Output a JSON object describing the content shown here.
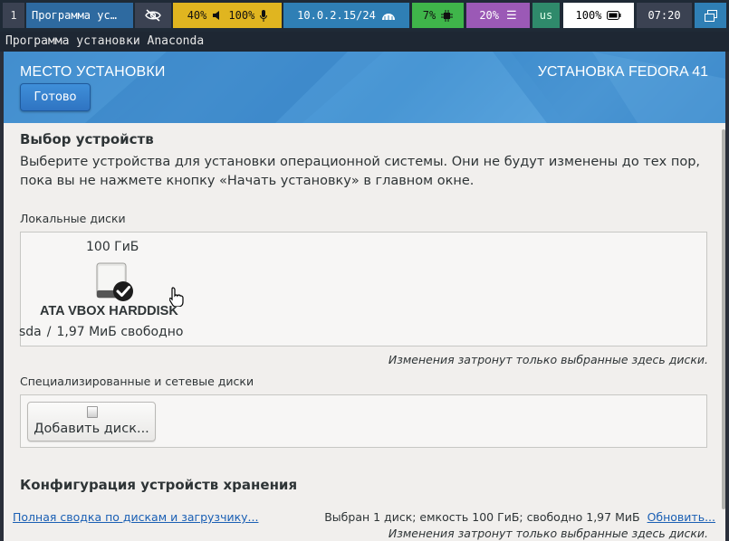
{
  "topbar": {
    "workspace": "1",
    "window_title": "Программа ус…",
    "volume": "40%",
    "mic": "100%",
    "network": "10.0.2.15/24",
    "cpu": "7%",
    "memory": "20%",
    "keyboard": "us",
    "battery": "100%",
    "clock": "07:20",
    "colors": {
      "audio": "#e0b520",
      "network": "#2f7fb5",
      "cpu": "#3fb54a",
      "memory": "#9b59b6",
      "keyboard": "#2f8a6b"
    }
  },
  "window": {
    "title": "Программа установки Anaconda"
  },
  "header": {
    "title": "МЕСТО УСТАНОВКИ",
    "product": "УСТАНОВКА FEDORA 41",
    "done_label": "Готово"
  },
  "device_selection": {
    "heading": "Выбор устройств",
    "description": "Выберите устройства для установки операционной системы. Они не будут изменены до тех пор, пока вы не нажмете кнопку «Начать установку» в главном окне."
  },
  "local_disks": {
    "label": "Локальные диски",
    "disks": [
      {
        "size": "100 ГиБ",
        "name": "ATA VBOX HARDDISK",
        "device": "sda",
        "separator": "/",
        "free": "1,97 МиБ свободно",
        "selected": true
      }
    ],
    "note": "Изменения затронут только выбранные здесь диски."
  },
  "specialized_disks": {
    "label": "Специализированные и сетевые диски",
    "add_label": "Добавить диск...",
    "note": "Изменения затронут только выбранные здесь диски."
  },
  "storage_config": {
    "heading": "Конфигурация устройств хранения"
  },
  "footer": {
    "summary_link": "Полная сводка по дискам и загрузчику...",
    "status": "Выбран 1 диск; емкость 100 ГиБ; свободно 1,97 МиБ",
    "refresh_link": "Обновить..."
  }
}
